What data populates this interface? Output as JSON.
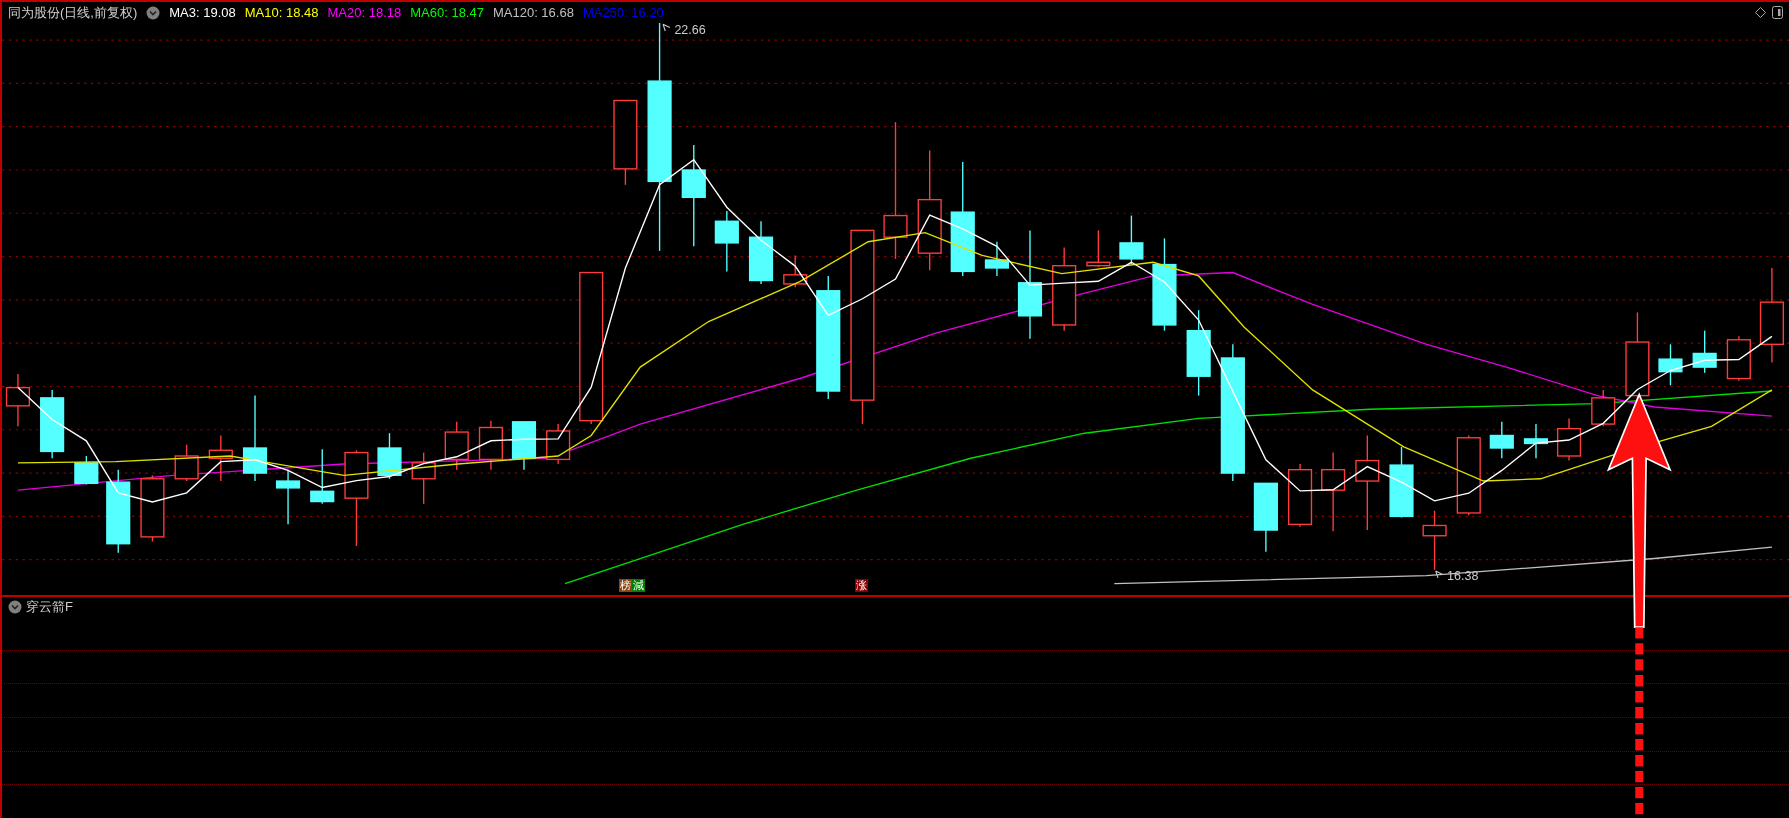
{
  "chart_header": {
    "title": "同为股份(日线,前复权)",
    "ma_legend": [
      {
        "text": "MA3: 19.08",
        "color": "#ffffff"
      },
      {
        "text": "MA10: 18.48",
        "color": "#ffff00"
      },
      {
        "text": "MA20: 18.18",
        "color": "#ff00ff"
      },
      {
        "text": "MA60: 18.47",
        "color": "#00ff00"
      },
      {
        "text": "MA120: 16.68",
        "color": "#c0c0c0"
      },
      {
        "text": "MA250: 16.20",
        "color": "#0000ff"
      }
    ]
  },
  "price_chart": {
    "high_label": "22.66",
    "low_label": "16.38",
    "markers": [
      {
        "text": "榜",
        "color": "#8b4513"
      },
      {
        "text": "減",
        "color": "#008000"
      },
      {
        "text": "涨",
        "color": "#8b0000"
      }
    ]
  },
  "indicator_panel": {
    "title": "穿云箭F"
  }
}
